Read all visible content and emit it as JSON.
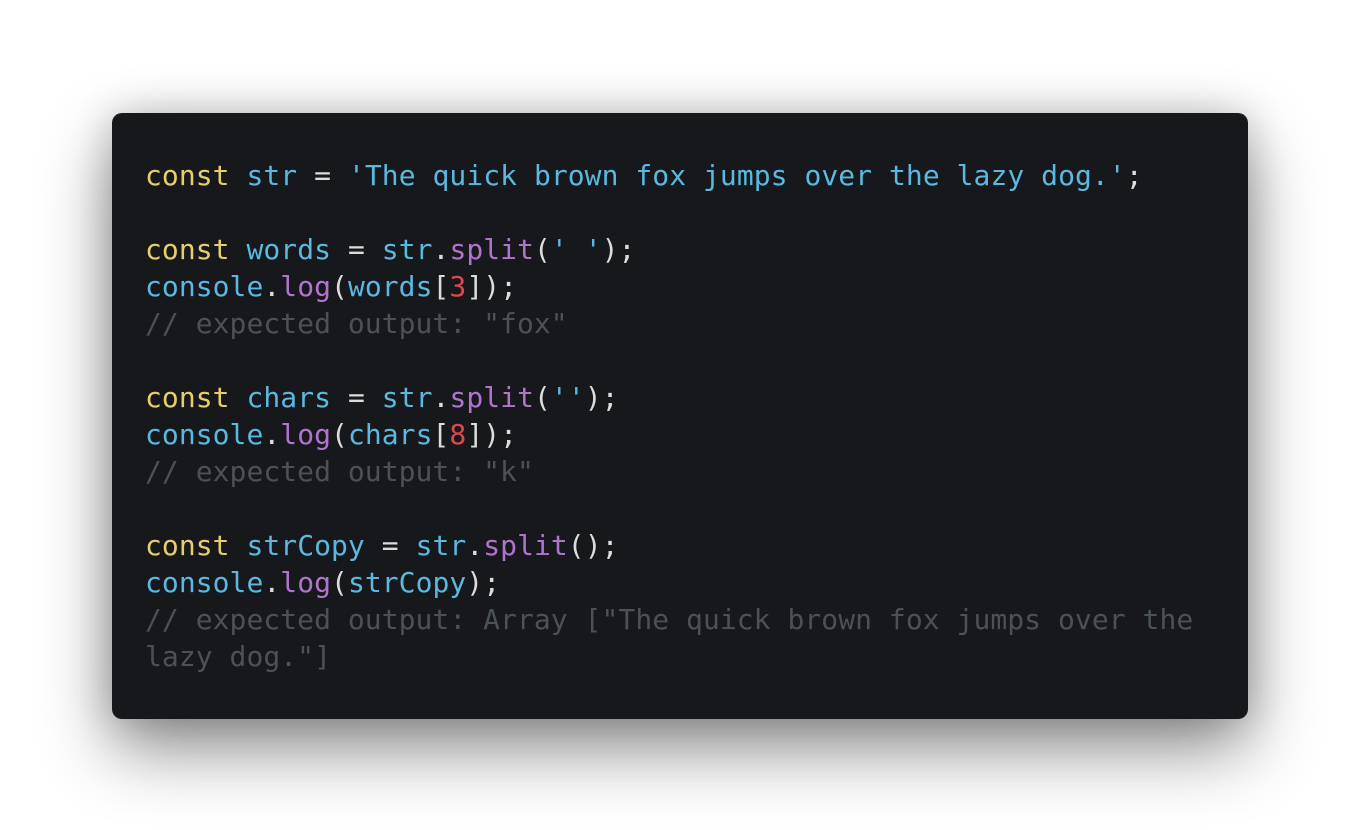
{
  "code": {
    "line1": {
      "kw": "const",
      "var": "str",
      "op": "=",
      "str": "'The quick brown fox jumps over the lazy dog.'",
      "end": ";"
    },
    "line2": {
      "kw": "const",
      "var": "words",
      "op": "=",
      "obj": "str",
      "dot": ".",
      "fn": "split",
      "open": "(",
      "arg": "' '",
      "close": ");"
    },
    "line3": {
      "obj": "console",
      "dot": ".",
      "fn": "log",
      "open": "(",
      "arg": "words",
      "lb": "[",
      "num": "3",
      "rb": "]",
      "close": ");"
    },
    "line4": {
      "comment": "// expected output: \"fox\""
    },
    "line5": {
      "kw": "const",
      "var": "chars",
      "op": "=",
      "obj": "str",
      "dot": ".",
      "fn": "split",
      "open": "(",
      "arg": "''",
      "close": ");"
    },
    "line6": {
      "obj": "console",
      "dot": ".",
      "fn": "log",
      "open": "(",
      "arg": "chars",
      "lb": "[",
      "num": "8",
      "rb": "]",
      "close": ");"
    },
    "line7": {
      "comment": "// expected output: \"k\""
    },
    "line8": {
      "kw": "const",
      "var": "strCopy",
      "op": "=",
      "obj": "str",
      "dot": ".",
      "fn": "split",
      "close": "();"
    },
    "line9": {
      "obj": "console",
      "dot": ".",
      "fn": "log",
      "open": "(",
      "arg": "strCopy",
      "close": ");"
    },
    "line10": {
      "comment": "// expected output: Array [\"The quick brown fox jumps over the"
    },
    "line11": {
      "comment": "lazy dog.\"]"
    }
  },
  "colors": {
    "background": "#17181b",
    "keyword": "#e6cf6a",
    "identifier": "#5bb8e0",
    "function": "#b074cc",
    "number": "#e0474c",
    "comment": "#4a5157",
    "punctuation": "#dcdcdc"
  }
}
